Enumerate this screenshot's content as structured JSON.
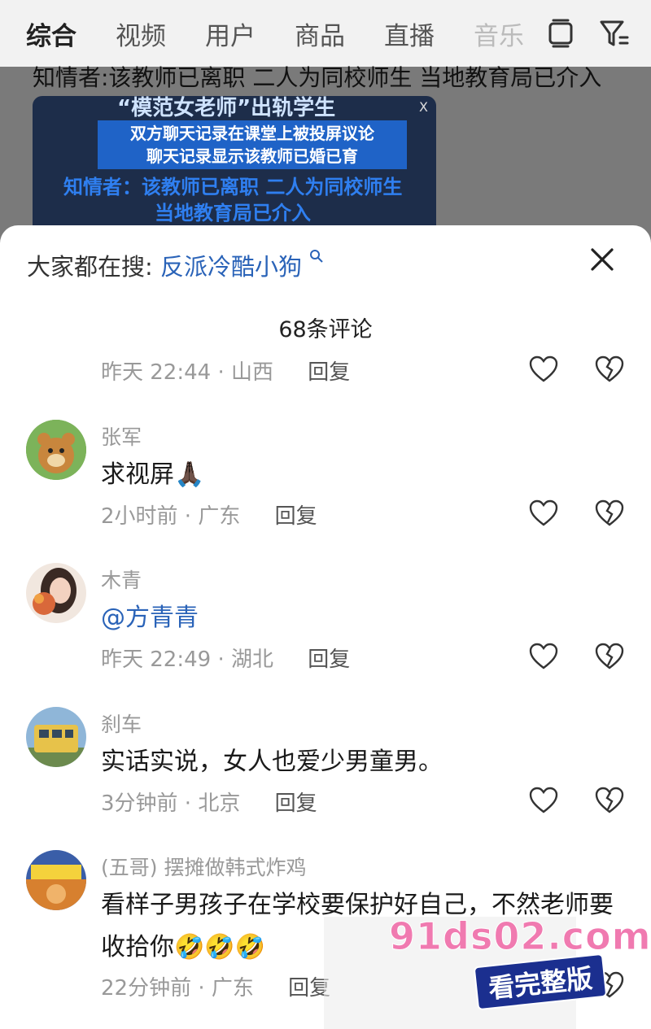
{
  "tabs": [
    "综合",
    "视频",
    "用户",
    "商品",
    "直播",
    "音乐"
  ],
  "background": {
    "headline": "知情者:该教师已离职 二人为同校师生 当地教育局已介入",
    "video_title": "“模范女老师”出轨学生",
    "video_lines": [
      "双方聊天记录在课堂上被投屏议论",
      "聊天记录显示该教师已婚已育"
    ],
    "video_line3": "知情者：该教师已离职 二人为同校师生",
    "video_line4": "当地教育局已介入",
    "video_close": "X"
  },
  "sheet": {
    "search_prefix": "大家都在搜:",
    "search_keyword": "反派冷酷小狗",
    "comment_count": "68条评论",
    "reply_label": "回复"
  },
  "top_meta": {
    "time_loc": "昨天 22:44 · 山西"
  },
  "comments": [
    {
      "name": "张军",
      "text": "求视屏🙏🏿",
      "time_loc": "2小时前 · 广东"
    },
    {
      "name": "木青",
      "text": "@方青青",
      "time_loc": "昨天 22:49 · 湖北"
    },
    {
      "name": "刹车",
      "text": "实话实说，女人也爱少男童男。",
      "time_loc": "3分钟前 · 北京"
    },
    {
      "name": "(五哥) 摆摊做韩式炸鸡",
      "text": "看样子男孩子在学校要保护好自己，不然老师要收拾你🤣🤣🤣",
      "time_loc": "22分钟前 · 广东"
    }
  ],
  "watermark": {
    "url": "91ds02.com",
    "badge": "看完整版"
  }
}
